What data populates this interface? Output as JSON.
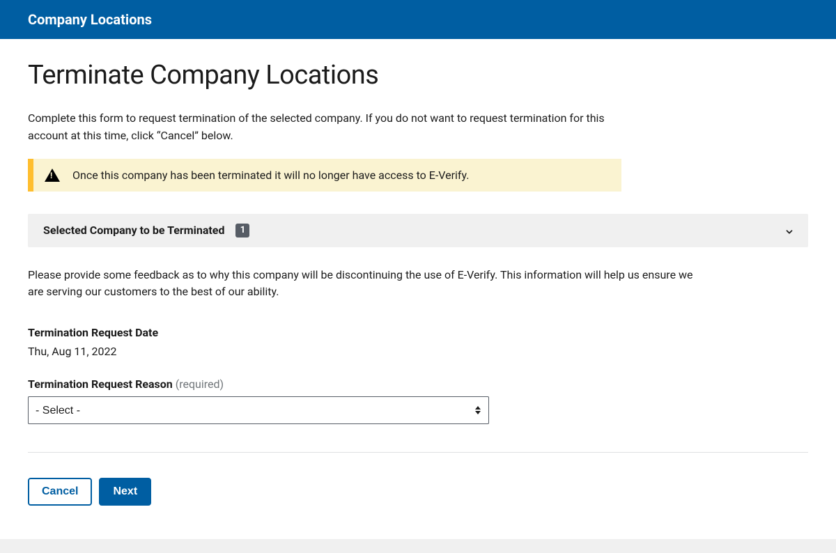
{
  "header": {
    "title": "Company Locations"
  },
  "page": {
    "title": "Terminate Company Locations",
    "intro": "Complete this form to request termination of the selected company. If you do not want to request termination for this account at this time, click “Cancel” below."
  },
  "alert": {
    "text": "Once this company has been terminated it will no longer have access to E-Verify."
  },
  "accordion": {
    "label": "Selected Company to be Terminated",
    "count": "1"
  },
  "feedback": {
    "text": "Please provide some feedback as to why this company will be discontinuing the use of E-Verify. This information will help us ensure we are serving our customers to the best of our ability."
  },
  "fields": {
    "request_date_label": "Termination Request Date",
    "request_date_value": "Thu, Aug 11, 2022",
    "reason_label": "Termination Request Reason",
    "reason_required": " (required)",
    "reason_placeholder": "- Select -"
  },
  "buttons": {
    "cancel": "Cancel",
    "next": "Next"
  }
}
